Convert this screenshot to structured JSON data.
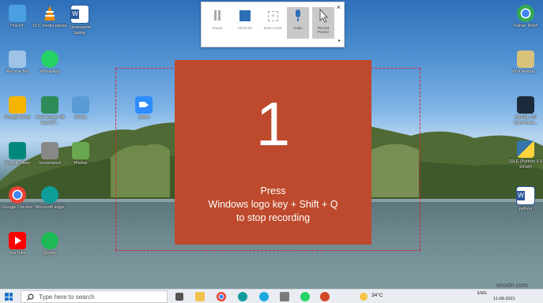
{
  "desktop_icons": [
    {
      "label": "This PC",
      "icon": "monitor-icon",
      "color": "#4a9fe0"
    },
    {
      "label": "VLC media player",
      "icon": "vlc-cone-icon",
      "color": "#f08c00"
    },
    {
      "label": "Cleanpaste laptop",
      "icon": "word-doc-icon",
      "color": "#2b579a"
    },
    {
      "label": "Recycle Bin",
      "icon": "recycle-bin-icon",
      "color": "#9ec3e6"
    },
    {
      "label": "WhatsApp",
      "icon": "whatsapp-icon",
      "color": "#25d366"
    },
    {
      "label": "Google Keep",
      "icon": "keep-icon",
      "color": "#f6b400"
    },
    {
      "label": "Anniversary 08 Card (P...",
      "icon": "card-icon",
      "color": "#2e8b57"
    },
    {
      "label": "Shelly",
      "icon": "network-monitor-icon",
      "color": "#5a9bd5"
    },
    {
      "label": "Zoom",
      "icon": "zoom-icon",
      "color": "#2d8cff"
    },
    {
      "label": "Google Meet",
      "icon": "meet-icon",
      "color": "#00897b"
    },
    {
      "label": "Screenshot",
      "icon": "camera-icon",
      "color": "#888888"
    },
    {
      "label": "Photos",
      "icon": "photo-icon",
      "color": "#6aa84f"
    },
    {
      "label": "Google Chrome",
      "icon": "chrome-icon",
      "color": "#4285f4"
    },
    {
      "label": "Microsoft Edge",
      "icon": "edge-icon",
      "color": "#0f9d9a"
    },
    {
      "label": "YouTube",
      "icon": "youtube-icon",
      "color": "#ff0000"
    },
    {
      "label": "Spotify",
      "icon": "spotify-icon",
      "color": "#1db954"
    },
    {
      "label": "Rahan RSM",
      "icon": "chrome-icon",
      "color": "#4285f4"
    },
    {
      "label": "ProDesktop...",
      "icon": "file-icon",
      "color": "#d9c27a"
    },
    {
      "label": "MySQL 8.0 Command...",
      "icon": "mysql-terminal-icon",
      "color": "#1b2b3b"
    },
    {
      "label": "IDLE (Python 3.9 64-bit)",
      "icon": "python-icon",
      "color": "#3776ab"
    },
    {
      "label": "python",
      "icon": "word-doc-icon",
      "color": "#2b579a"
    }
  ],
  "recorder": {
    "pause_label": "Pause",
    "timer": "00:00:00",
    "select_area_label": "Select Area",
    "audio_label": "Audio",
    "record_pointer_label": "Record Pointer",
    "close": "×",
    "expand": "▸"
  },
  "overlay": {
    "number": "1",
    "line1": "Press",
    "line2": "Windows logo key + Shift + Q",
    "line3": "to stop recording",
    "color": "#be4a2d"
  },
  "taskbar": {
    "search_placeholder": "Type here to search",
    "weather": "34°C",
    "language": "ENG",
    "date": "11-08-2021",
    "watermark": "wsxdn.com"
  }
}
